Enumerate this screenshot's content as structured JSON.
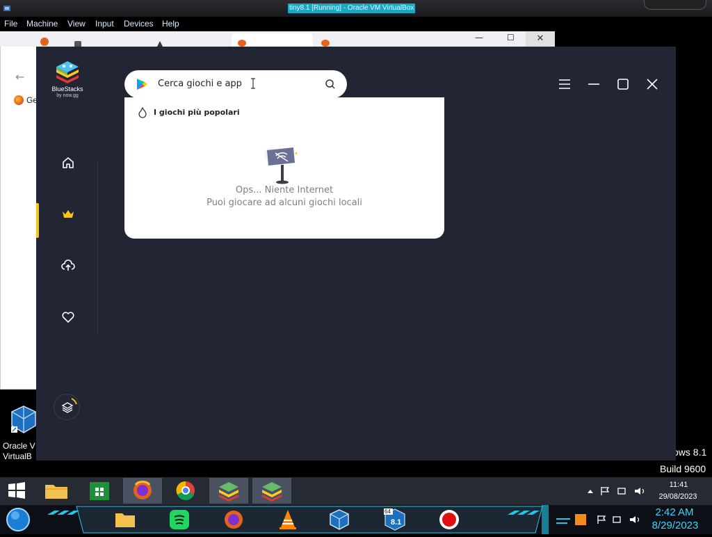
{
  "vbox": {
    "title": "tiny8.1 [Running] - Oracle VM VirtualBox",
    "menu": [
      "File",
      "Machine",
      "View",
      "Input",
      "Devices",
      "Help"
    ]
  },
  "firefox": {
    "window_controls": [
      "—",
      "☐",
      "✕"
    ],
    "back_glyph": "←",
    "bookmark_text": "Ge"
  },
  "desktop": {
    "vbox_icon_label_1": "Oracle V",
    "vbox_icon_label_2": "VirtualB",
    "watermark_line1": "ows 8.1",
    "watermark_line2": "Build 9600"
  },
  "bluestacks": {
    "brand": "BlueStacks",
    "brand_sub": "by now.gg",
    "search_placeholder": "Cerca giochi e app",
    "popular_label": "I giochi più popolari",
    "no_internet_title": "Ops... Niente Internet",
    "no_internet_sub": "Puoi giocare ad alcuni giochi locali",
    "sidebar": [
      "home-icon",
      "crown-icon",
      "cloud-upload-icon",
      "heart-icon"
    ],
    "accent": "#f5c518",
    "bg": "#222533"
  },
  "taskbar": {
    "time": "11:41",
    "date": "29/08/2023"
  },
  "host_taskbar": {
    "time": "2:42 AM",
    "date": "8/29/2023",
    "badge": "8.1",
    "badge_top": "64"
  }
}
